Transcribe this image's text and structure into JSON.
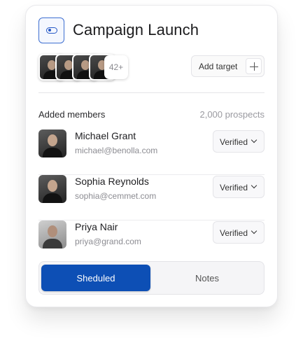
{
  "header": {
    "title": "Campaign Launch",
    "toggle_icon": "toggle-icon"
  },
  "avatars": {
    "more_count": "42+"
  },
  "actions": {
    "add_target_label": "Add target"
  },
  "members": {
    "heading": "Added members",
    "prospects": "2,000 prospects",
    "list": [
      {
        "name": "Michael Grant",
        "email": "michael@benolla.com",
        "status": "Verified"
      },
      {
        "name": "Sophia Reynolds",
        "email": "sophia@cemmet.com",
        "status": "Verified"
      },
      {
        "name": "Priya Nair",
        "email": "priya@grand.com",
        "status": "Verified"
      }
    ]
  },
  "tabs": [
    {
      "label": "Sheduled",
      "active": true
    },
    {
      "label": "Notes",
      "active": false
    }
  ],
  "colors": {
    "accent": "#0d4fb5"
  }
}
